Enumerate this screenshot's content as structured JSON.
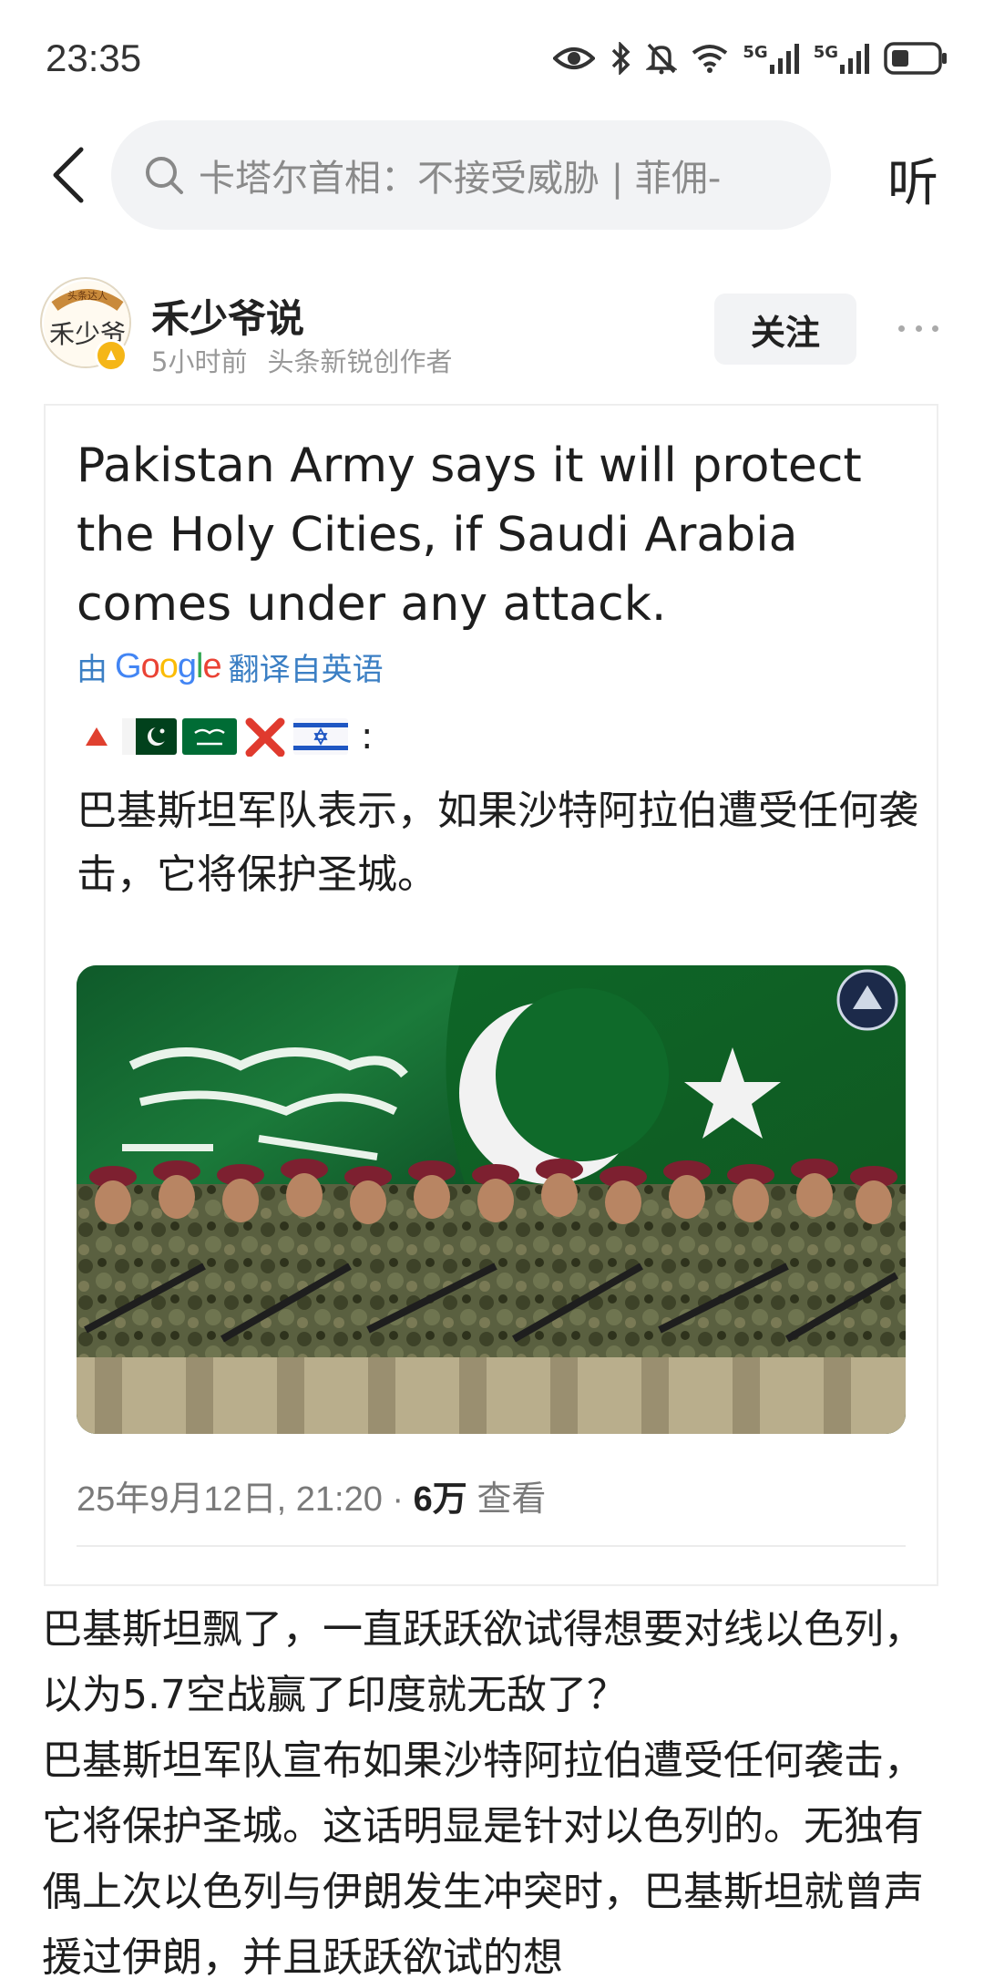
{
  "status_bar": {
    "time": "23:35",
    "icons": [
      "eye-icon",
      "bluetooth-icon",
      "mute-icon",
      "wifi-icon",
      "signal-5g-icon",
      "signal-5g-icon",
      "battery-icon"
    ],
    "network_label_1": "5G",
    "network_label_2": "5G"
  },
  "nav": {
    "back_icon": "chevron-left-icon",
    "search_icon": "search-icon",
    "search_text": "卡塔尔首相：不接受威胁 | 菲佣-",
    "listen_label": "听"
  },
  "author": {
    "name": "禾少爷说",
    "time_ago": "5小时前",
    "role": "头条新锐创作者",
    "follow_label": "关注",
    "avatar_text": "禾少爷",
    "avatar_ring_text": "头条达人"
  },
  "tweet": {
    "text_en": "Pakistan Army says it will protect the Holy Cities, if Saudi Arabia comes under any attack.",
    "translate_prefix": "由",
    "translate_brand": "Google",
    "translate_suffix": "翻译自英语",
    "flags_suffix": ":",
    "text_zh": "巴基斯坦军队表示，如果沙特阿拉伯遭受任何袭击，它将保护圣城。",
    "date": "25年9月12日, 21:20 · ",
    "views_count": "6万",
    "views_label": " 查看",
    "image_alt": "Saudi and Pakistan flags with marching Pakistani soldiers"
  },
  "article": {
    "paragraph_1": "巴基斯坦飘了，一直跃跃欲试得想要对线以色列，以为5.7空战赢了印度就无敌了？",
    "paragraph_2": "巴基斯坦军队宣布如果沙特阿拉伯遭受任何袭击，它将保护圣城。这话明显是针对以色列的。无独有偶上次以色列与伊朗发生冲突时，巴基斯坦就曾声援过伊朗，并且跃跃欲试的想"
  },
  "colors": {
    "accent_blue": "#3b7fc4",
    "pakistan_green": "#01411c",
    "saudi_green": "#006c35",
    "search_bg": "#f2f3f5"
  }
}
